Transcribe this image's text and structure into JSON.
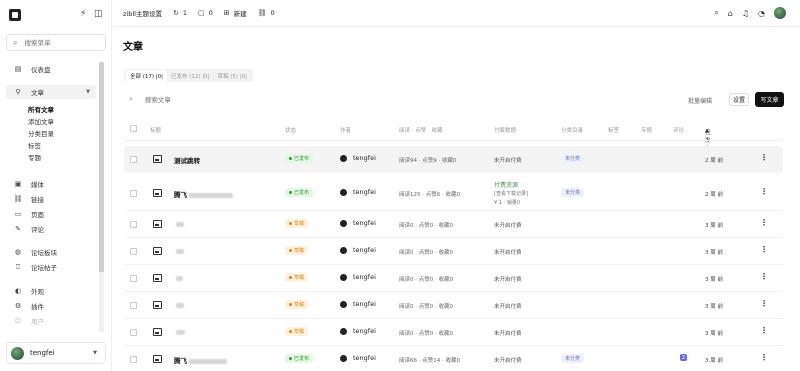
{
  "sidebar": {
    "search_placeholder": "搜索菜单",
    "items": [
      {
        "label": "仪表盘",
        "icon": "dashboard-icon"
      },
      {
        "label": "文章",
        "icon": "pin-icon"
      },
      {
        "label": "媒体",
        "icon": "media-icon"
      },
      {
        "label": "链接",
        "icon": "link-icon"
      },
      {
        "label": "页面",
        "icon": "page-icon"
      },
      {
        "label": "评论",
        "icon": "comment-icon"
      },
      {
        "label": "论坛板块",
        "icon": "forum-icon"
      },
      {
        "label": "论坛帖子",
        "icon": "forum-post-icon"
      },
      {
        "label": "外观",
        "icon": "palette-icon"
      },
      {
        "label": "插件",
        "icon": "plugin-icon"
      },
      {
        "label": "用户",
        "icon": "user-icon"
      }
    ],
    "sub_items": [
      "所有文章",
      "添加文章",
      "分类目录",
      "标签",
      "专题"
    ],
    "user_name": "tengfei"
  },
  "topbar": {
    "site_settings": "zibll主题设置",
    "updates_count": "1",
    "comments_count": "0",
    "new_label": "新建",
    "links_count": "0"
  },
  "main": {
    "page_title": "文章",
    "filters": [
      {
        "label": "全部 (17)",
        "extra": "|0|"
      },
      {
        "label": "已发布 (12)",
        "extra": "|0|"
      },
      {
        "label": "草稿 (5)",
        "extra": "|0|"
      }
    ],
    "search_placeholder": "搜索文章",
    "batch_label": "批量编辑",
    "settings_label": "设置",
    "write_label": "写文章",
    "columns": {
      "title": "标题",
      "status": "状态",
      "author": "作者",
      "stats": "阅读 · 点赞 · 收藏",
      "pay": "付费数据",
      "category": "分类目录",
      "tags": "标签",
      "topic": "专题",
      "comments": "评论",
      "published": "已发布"
    },
    "rows": [
      {
        "title": "测试跳转",
        "status": "已发布",
        "author": "tengfei",
        "stats": "阅读94 · 点赞9 · 收藏0",
        "pay": "未开启付费",
        "pay2": "",
        "pay3": "",
        "category": "未分类",
        "comments": "",
        "date": "2 周 前"
      },
      {
        "title": "腾飞",
        "status": "已发布",
        "author": "tengfei",
        "stats": "阅读125 · 点赞6 · 收藏0",
        "pay": "付费资源",
        "pay2": "[查看下载记录]",
        "pay3": "¥:1 · 销量0",
        "category": "未分类",
        "comments": "",
        "date": "2 周 前"
      },
      {
        "title": "",
        "status": "草稿",
        "author": "tengfei",
        "stats": "阅读0 · 点赞0 · 收藏0",
        "pay": "未开启付费",
        "pay2": "",
        "pay3": "",
        "category": "",
        "comments": "",
        "date": "3 周 前"
      },
      {
        "title": "",
        "status": "草稿",
        "author": "tengfei",
        "stats": "阅读0 · 点赞0 · 收藏0",
        "pay": "未开启付费",
        "pay2": "",
        "pay3": "",
        "category": "",
        "comments": "",
        "date": "3 周 前"
      },
      {
        "title": "",
        "status": "草稿",
        "author": "tengfei",
        "stats": "阅读0 · 点赞0 · 收藏0",
        "pay": "未开启付费",
        "pay2": "",
        "pay3": "",
        "category": "",
        "comments": "",
        "date": "3 周 前"
      },
      {
        "title": "",
        "status": "草稿",
        "author": "tengfei",
        "stats": "阅读0 · 点赞0 · 收藏0",
        "pay": "未开启付费",
        "pay2": "",
        "pay3": "",
        "category": "",
        "comments": "",
        "date": "3 周 前"
      },
      {
        "title": "",
        "status": "草稿",
        "author": "tengfei",
        "stats": "阅读0 · 点赞0 · 收藏0",
        "pay": "未开启付费",
        "pay2": "",
        "pay3": "",
        "category": "",
        "comments": "",
        "date": "3 周 前"
      },
      {
        "title": "腾飞",
        "status": "已发布",
        "author": "tengfei",
        "stats": "阅读66 · 点赞14 · 收藏0",
        "pay": "未开启付费",
        "pay2": "",
        "pay3": "",
        "category": "未分类",
        "comments": "2",
        "date": "3 周 前"
      }
    ]
  },
  "colors": {
    "accent": "#111111",
    "published": "#3a9a3a",
    "draft": "#d48a1c",
    "category": "#6a6fb5",
    "comment_badge": "#6c6cd8"
  }
}
